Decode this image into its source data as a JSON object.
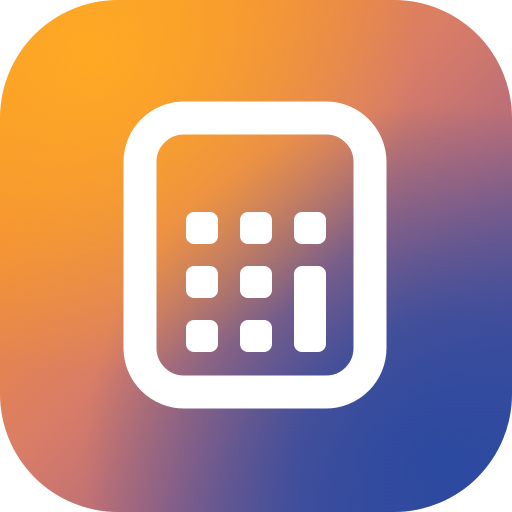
{
  "app_icon": {
    "icon_name": "calculator-icon",
    "colors": {
      "orange": "#f79a25",
      "rose": "#d87c68",
      "mauve": "#b46b7b",
      "blue": "#3d4ea0",
      "foreground": "#ffffff"
    }
  }
}
